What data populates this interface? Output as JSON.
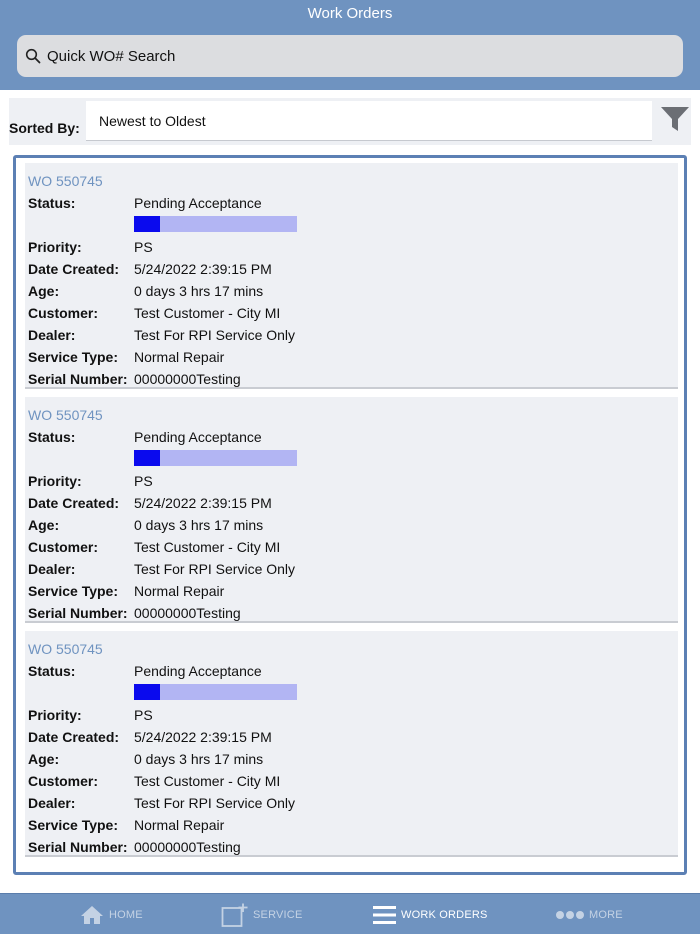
{
  "header": {
    "title": "Work Orders"
  },
  "search": {
    "placeholder": "Quick WO# Search",
    "value": ""
  },
  "sort": {
    "label": "Sorted By:",
    "value": "Newest to Oldest"
  },
  "field_labels": {
    "status": "Status:",
    "priority": "Priority:",
    "date_created": "Date Created:",
    "age": "Age:",
    "customer": "Customer:",
    "dealer": "Dealer:",
    "service_type": "Service Type:",
    "serial_number": "Serial Number:"
  },
  "work_orders": [
    {
      "title": "WO 550745",
      "status": "Pending Acceptance",
      "progress_fraction": 0.16,
      "priority": "PS",
      "date_created": "5/24/2022 2:39:15 PM",
      "age": "0 days 3 hrs 17 mins",
      "customer": "Test Customer - City MI",
      "dealer": "Test For RPI Service Only",
      "service_type": "Normal Repair",
      "serial_number": "00000000Testing"
    },
    {
      "title": "WO 550745",
      "status": "Pending Acceptance",
      "progress_fraction": 0.16,
      "priority": "PS",
      "date_created": "5/24/2022 2:39:15 PM",
      "age": "0 days 3 hrs 17 mins",
      "customer": "Test Customer - City MI",
      "dealer": "Test For RPI Service Only",
      "service_type": "Normal Repair",
      "serial_number": "00000000Testing"
    },
    {
      "title": "WO 550745",
      "status": "Pending Acceptance",
      "progress_fraction": 0.16,
      "priority": "PS",
      "date_created": "5/24/2022 2:39:15 PM",
      "age": "0 days 3 hrs 17 mins",
      "customer": "Test Customer - City MI",
      "dealer": "Test For RPI Service Only",
      "service_type": "Normal Repair",
      "serial_number": "00000000Testing"
    }
  ],
  "tabbar": {
    "items": [
      {
        "label": "HOME",
        "icon": "home-icon",
        "active": false
      },
      {
        "label": "SERVICE",
        "icon": "new-service-icon",
        "active": false
      },
      {
        "label": "WORK ORDERS",
        "icon": "list-icon",
        "active": true
      },
      {
        "label": "MORE",
        "icon": "more-icon",
        "active": false
      }
    ]
  },
  "colors": {
    "header_bg": "#6f93c0",
    "progress_fill": "#0a0aee",
    "progress_track": "#b2b5f3",
    "list_border": "#5c80b4",
    "card_title": "#6f93c0"
  }
}
